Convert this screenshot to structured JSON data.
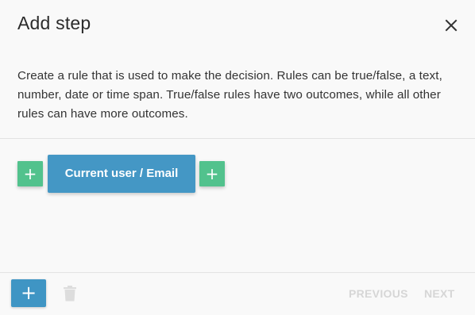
{
  "dialog": {
    "title": "Add step",
    "description": "Create a rule that is used to make the decision. Rules can be true/false, a text, number, date or time span. True/false rules have two outcomes, while all other rules can have more outcomes."
  },
  "rule": {
    "chip_label": "Current user / Email",
    "add_before_label": "+",
    "add_after_label": "+"
  },
  "footer": {
    "add_label": "+",
    "previous_label": "PREVIOUS",
    "next_label": "NEXT"
  },
  "colors": {
    "chip": "#4497c5",
    "add_green": "#52c28d",
    "footer_add": "#3f95c4",
    "disabled_text": "#d6d6d6"
  },
  "icons": {
    "close": "close-icon",
    "trash": "trash-icon"
  }
}
